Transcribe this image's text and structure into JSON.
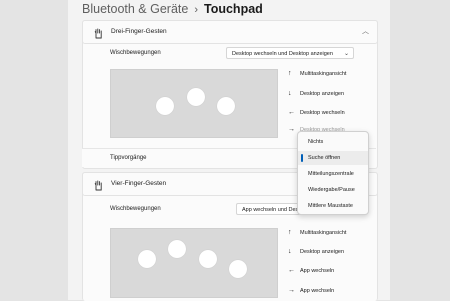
{
  "breadcrumb": {
    "parent": "Bluetooth & Geräte",
    "separator": "›",
    "current": "Touchpad"
  },
  "three_finger": {
    "header": "Drei-Finger-Gesten",
    "swipes_label": "Wischbewegungen",
    "swipes_value": "Desktop wechseln und Desktop anzeigen",
    "gestures": [
      {
        "arrow": "↑",
        "label": "Multitaskingansicht"
      },
      {
        "arrow": "↓",
        "label": "Desktop anzeigen"
      },
      {
        "arrow": "←",
        "label": "Desktop wechseln"
      },
      {
        "arrow": "→",
        "label": "Desktop wechseln"
      }
    ],
    "taps_label": "Tippvorgänge"
  },
  "tap_menu": {
    "items": [
      "Nichts",
      "Suche öffnen",
      "Mitteilungszentrale",
      "Wiedergabe/Pause",
      "Mittlere Maustaste"
    ],
    "selected": "Suche öffnen",
    "accent_color": "#005fb8"
  },
  "four_finger": {
    "header": "Vier-Finger-Gesten",
    "swipes_label": "Wischbewegungen",
    "swipes_value": "App wechseln und Desktop anzeigen",
    "gestures": [
      {
        "arrow": "↑",
        "label": "Multitaskingansicht"
      },
      {
        "arrow": "↓",
        "label": "Desktop anzeigen"
      },
      {
        "arrow": "←",
        "label": "App wechseln"
      },
      {
        "arrow": "→",
        "label": "App wechseln"
      }
    ]
  },
  "icons": {
    "gesture_icon": "hand-icon",
    "collapse_icon": "chevron-up-icon",
    "dropdown_icon": "chevron-down-icon"
  }
}
